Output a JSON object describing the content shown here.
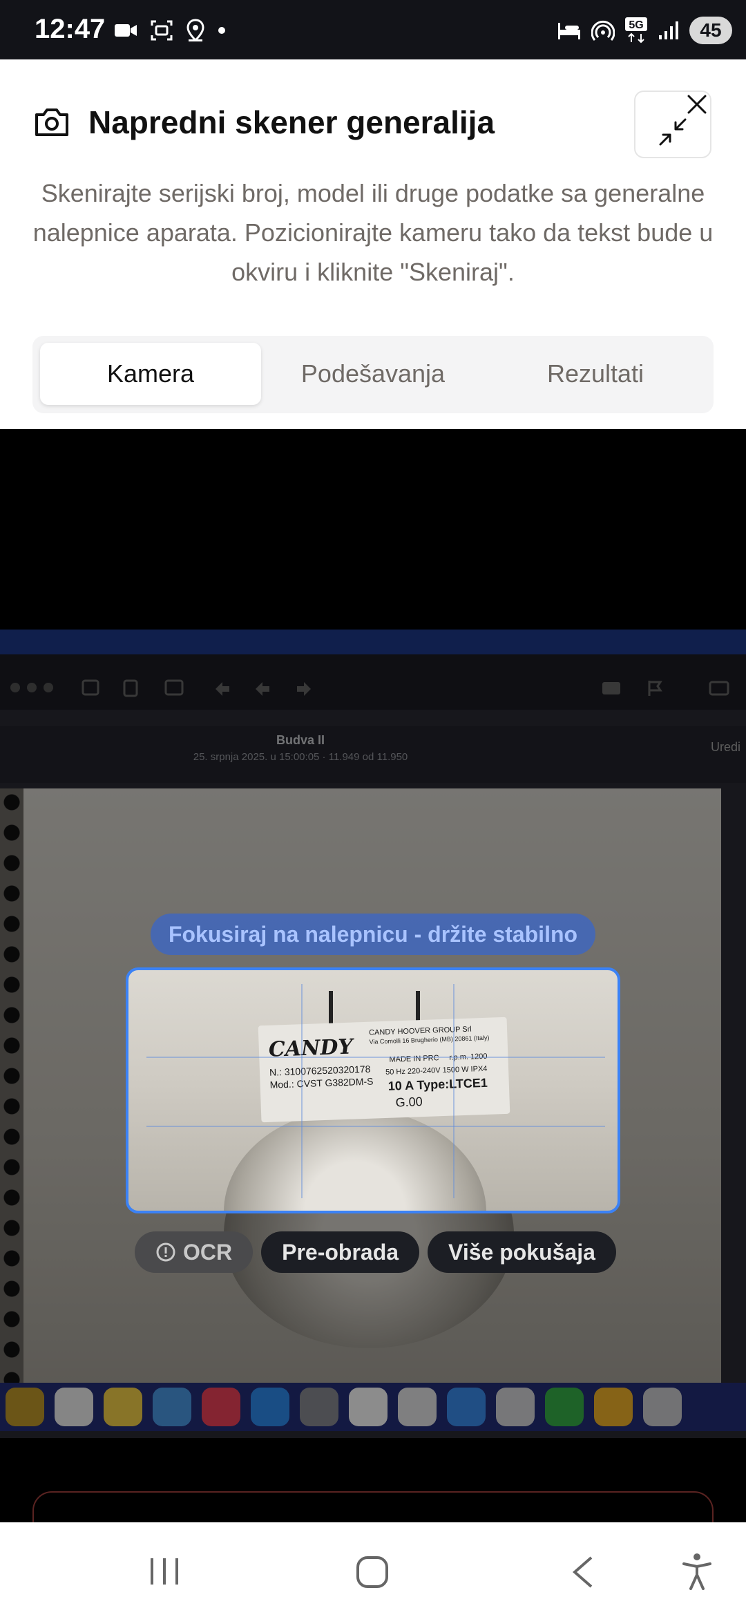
{
  "status_bar": {
    "time": "12:47",
    "battery": "45",
    "network": "5G",
    "left_icons": [
      "video-camera-icon",
      "screenshot-icon",
      "location-icon",
      "dot-icon"
    ],
    "right_icons": [
      "sleep-mode-icon",
      "hotspot-icon",
      "signal-5g-icon",
      "signal-bars-icon"
    ]
  },
  "header": {
    "title": "Napredni skener generalija",
    "description": "Skenirajte serijski broj, model ili druge podatke sa generalne nalepnice aparata. Pozicionirajte kameru tako da tekst bude u okviru i kliknite \"Skeniraj\".",
    "icon": "camera-icon"
  },
  "tabs": [
    {
      "label": "Kamera",
      "active": true
    },
    {
      "label": "Podešavanja",
      "active": false
    },
    {
      "label": "Rezultati",
      "active": false
    }
  ],
  "camera": {
    "hint": "Fokusiraj na nalepnicu - držite stabilno",
    "options": [
      {
        "label": "OCR",
        "icon": "info-circle-icon",
        "active": false
      },
      {
        "label": "Pre-obrada",
        "active": true
      },
      {
        "label": "Više pokušaja",
        "active": true
      }
    ],
    "photo": {
      "image_title": "Budva II",
      "image_subtitle": "25. srpnja 2025. u 15:00:05 · 11.949 od 11.950",
      "edit_label": "Uredi",
      "label_brand": "CANDY",
      "label_company": "CANDY HOOVER GROUP Srl",
      "label_address": "Via Comolli 16 Brugherio (MB) 20861 (Italy)",
      "label_serial": "N.: 3100762520320178",
      "label_model": "Mod.: CVST G382DM-S",
      "label_made": "MADE IN PRC",
      "label_rpm": "r.p.m. 1200",
      "label_power": "50 Hz  220-240V  1500 W IPX4",
      "label_type": "10 A  Type:LTCE1",
      "label_code": "G.00"
    }
  },
  "colors": {
    "accent_blue": "#3b82f6",
    "title_text": "#111111",
    "muted_text": "#6f6a66",
    "tab_bg": "#f4f4f5"
  },
  "nav_bar": {
    "buttons": [
      "recent-apps-icon",
      "home-icon",
      "back-icon",
      "accessibility-icon"
    ]
  }
}
